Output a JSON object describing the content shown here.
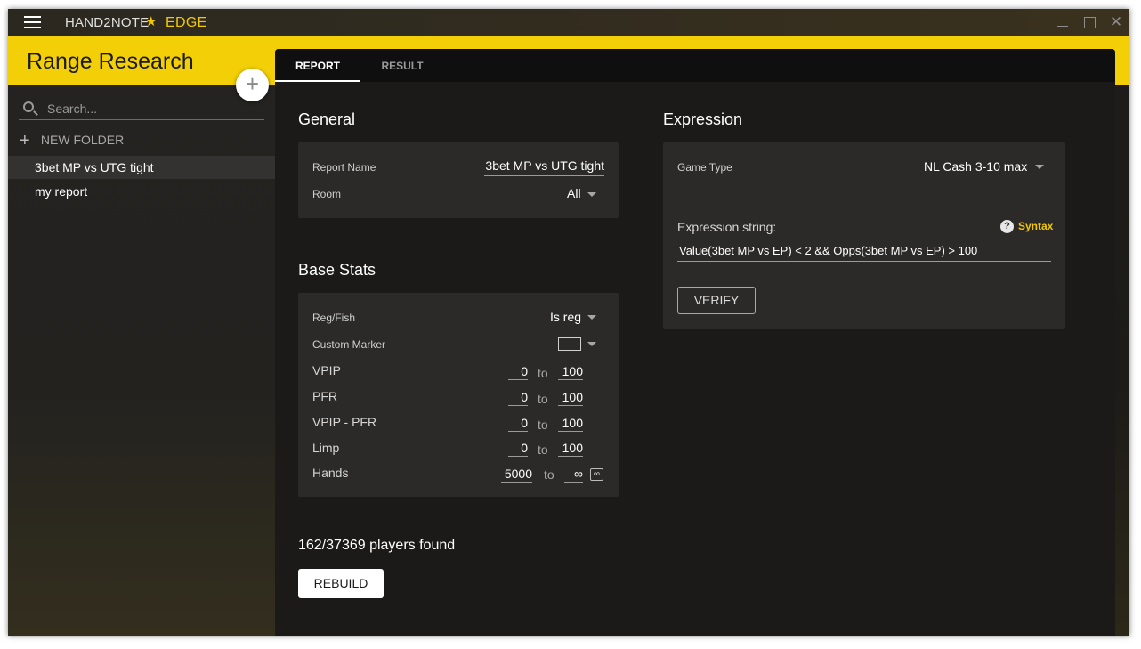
{
  "titlebar": {
    "brand": "HAND2NOTE",
    "edition": "EDGE",
    "close_glyph": "✕"
  },
  "sidebar": {
    "title": "Range Research",
    "search_placeholder": "Search...",
    "new_folder_label": "NEW FOLDER",
    "reports": [
      {
        "label": "3bet MP vs UTG tight",
        "active": true
      },
      {
        "label": "my report",
        "active": false
      }
    ]
  },
  "tabs": [
    {
      "label": "REPORT",
      "active": true
    },
    {
      "label": "RESULT",
      "active": false
    }
  ],
  "general": {
    "title": "General",
    "report_name_label": "Report Name",
    "report_name_value": "3bet MP vs UTG tight",
    "room_label": "Room",
    "room_value": "All"
  },
  "base_stats": {
    "title": "Base Stats",
    "reg_fish_label": "Reg/Fish",
    "reg_fish_value": "Is reg",
    "custom_marker_label": "Custom Marker",
    "to_label": "to",
    "rows": [
      {
        "label": "VPIP",
        "from": "0",
        "to": "100"
      },
      {
        "label": "PFR",
        "from": "0",
        "to": "100"
      },
      {
        "label": "VPIP - PFR",
        "from": "0",
        "to": "100"
      },
      {
        "label": "Limp",
        "from": "0",
        "to": "100"
      },
      {
        "label": "Hands",
        "from": "5000",
        "to": "∞"
      }
    ],
    "infinity_toggle": "∞"
  },
  "results": {
    "players_found": "162/37369 players found",
    "rebuild_label": "REBUILD"
  },
  "expression": {
    "title": "Expression",
    "game_type_label": "Game Type",
    "game_type_value": "NL Cash 3-10 max",
    "expression_label": "Expression string:",
    "help_glyph": "?",
    "syntax_label": "Syntax",
    "expression_value": "Value(3bet MP vs EP) < 2 && Opps(3bet MP vs EP) > 100",
    "verify_label": "VERIFY"
  },
  "icons": {
    "menu": "hamburger-menu-icon",
    "star": "star-icon",
    "search": "search-icon",
    "add": "plus-icon",
    "caret": "chevron-down-icon",
    "help": "help-icon"
  },
  "colors": {
    "accent": "#f2cf06",
    "brand_yellow": "#f2c800",
    "panel": "#2b2a28",
    "background": "#1b1a18"
  }
}
